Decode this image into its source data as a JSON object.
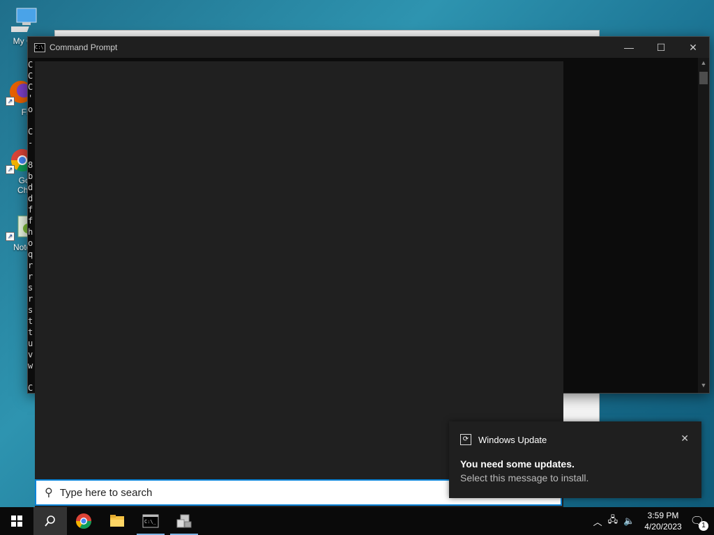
{
  "desktop": {
    "icons": [
      {
        "label": "My Co",
        "icon": "computer-icon"
      },
      {
        "label": "Fire",
        "icon": "firefox-icon"
      },
      {
        "label": "Goo\nChro",
        "icon": "chrome-icon"
      },
      {
        "label": "Notep",
        "icon": "notepad-icon"
      }
    ]
  },
  "cmd_window": {
    "title": "Command Prompt",
    "minimize_glyph": "—",
    "maximize_glyph": "☐",
    "close_glyph": "✕",
    "visible_line_starts": "C\nC\nC\n'\no\n\nC\n-\n\n8\nb\nd\nd\nf\nf\nh\no\nq\nr\nr\ns\nr\ns\nt\nt\nu\nv\nw\n\nC"
  },
  "search": {
    "placeholder": "Type here to search",
    "icon": "search-icon"
  },
  "toast": {
    "app": "Windows Update",
    "heading": "You need some updates.",
    "body": "Select this message to install.",
    "close_glyph": "✕"
  },
  "taskbar": {
    "apps": [
      "start-icon",
      "search-icon",
      "chrome-icon",
      "file-explorer-icon",
      "command-prompt-icon",
      "network-app-icon"
    ],
    "clock_time": "3:59 PM",
    "clock_date": "4/20/2023",
    "notification_count": "1"
  }
}
